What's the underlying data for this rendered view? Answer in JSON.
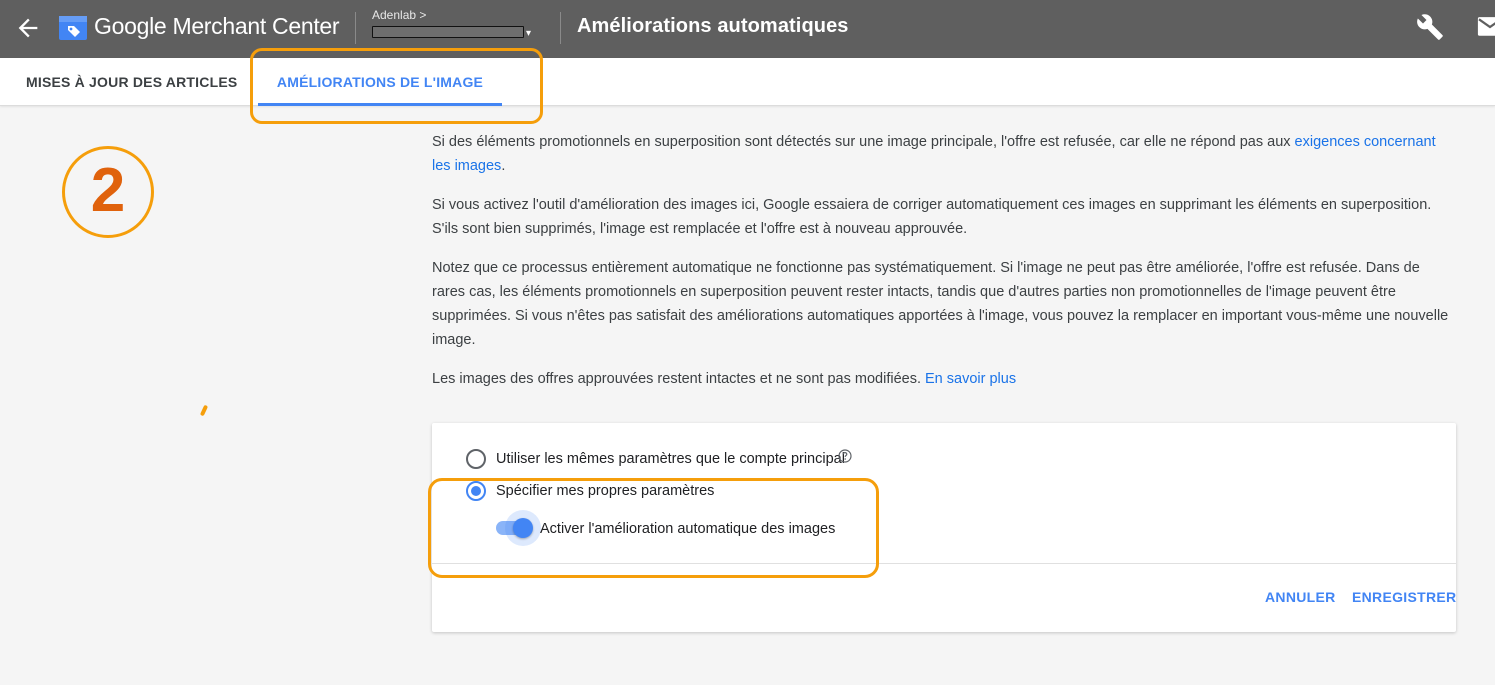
{
  "topbar": {
    "brand": "Google Merchant Center",
    "account_name": "Adenlab",
    "account_caret": ">",
    "account_dropdown_caret": "▾",
    "page_title": "Améliorations automatiques",
    "icons": {
      "back": "arrow-left-icon",
      "logo": "merchant-center-tag-icon",
      "tools": "wrench-icon",
      "mail": "mail-icon"
    }
  },
  "tabs": [
    {
      "label": "MISES À JOUR DES ARTICLES",
      "active": false
    },
    {
      "label": "AMÉLIORATIONS DE L'IMAGE",
      "active": true
    }
  ],
  "step_number": "2",
  "content": {
    "p1_text": "Si des éléments promotionnels en superposition sont détectés sur une image principale, l'offre est refusée, car elle ne répond pas aux ",
    "p1_link": "exigences concernant les images",
    "p1_end": ".",
    "p2": "Si vous activez l'outil d'amélioration des images ici, Google essaiera de corriger automatiquement ces images en supprimant les éléments en superposition. S'ils sont bien supprimés, l'image est remplacée et l'offre est à nouveau approuvée.",
    "p3": "Notez que ce processus entièrement automatique ne fonctionne pas systématiquement. Si l'image ne peut pas être améliorée, l'offre est refusée. Dans de rares cas, les éléments promotionnels en superposition peuvent rester intacts, tandis que d'autres parties non promotionnelles de l'image peuvent être supprimées. Si vous n'êtes pas satisfait des améliorations automatiques apportées à l'image, vous pouvez la remplacer en important vous-même une nouvelle image.",
    "p4_text": "Les images des offres approuvées restent intactes et ne sont pas modifiées. ",
    "p4_link": "En savoir plus"
  },
  "settings": {
    "option_same": "Utiliser les mêmes paramètres que le compte principal",
    "option_own": "Spécifier mes propres paramètres",
    "selected": "option_own",
    "toggle_label": "Activer l'amélioration automatique des images",
    "toggle_on": true,
    "cancel_label": "ANNULER",
    "save_label": "ENREGISTRER"
  },
  "colors": {
    "topbar": "#5f5f5f",
    "accent_blue": "#4285f4",
    "link_blue": "#1a73e8",
    "highlight_orange": "#f59e0b",
    "step_number": "#e0620c"
  }
}
